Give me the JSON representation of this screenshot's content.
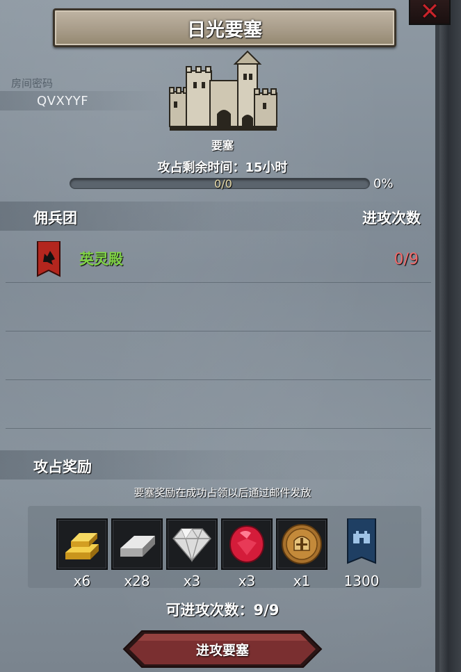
{
  "title": "日光要塞",
  "room": {
    "label": "房间密码",
    "code": "QVXYYF"
  },
  "fortress": {
    "label": "要塞",
    "time_remaining": "攻占剩余时间：15小时",
    "progress_text": "0/0",
    "progress_percent_text": "0%",
    "progress_fraction": 0
  },
  "table": {
    "col_guild": "佣兵团",
    "col_attacks": "进攻次数",
    "rows": [
      {
        "name": "英灵殿",
        "attacks": "0/9"
      }
    ]
  },
  "rewards": {
    "title": "攻占奖励",
    "note": "要塞奖励在成功占领以后通过邮件发放",
    "items": [
      {
        "icon": "gold-bar-icon",
        "qty": "x6"
      },
      {
        "icon": "iron-ingot-icon",
        "qty": "x28"
      },
      {
        "icon": "diamond-icon",
        "qty": "x3"
      },
      {
        "icon": "ruby-icon",
        "qty": "x3"
      },
      {
        "icon": "knight-coin-icon",
        "qty": "x1"
      },
      {
        "icon": "fortress-banner-icon",
        "qty": "1300"
      }
    ]
  },
  "attacks_available": "可进攻次数：9/9",
  "attack_button_label": "进攻要塞",
  "colors": {
    "guild_name": "#7fd145",
    "attack_count": "#ef6a6a",
    "close_x": "#c8232a",
    "button": "#7a2f30"
  }
}
